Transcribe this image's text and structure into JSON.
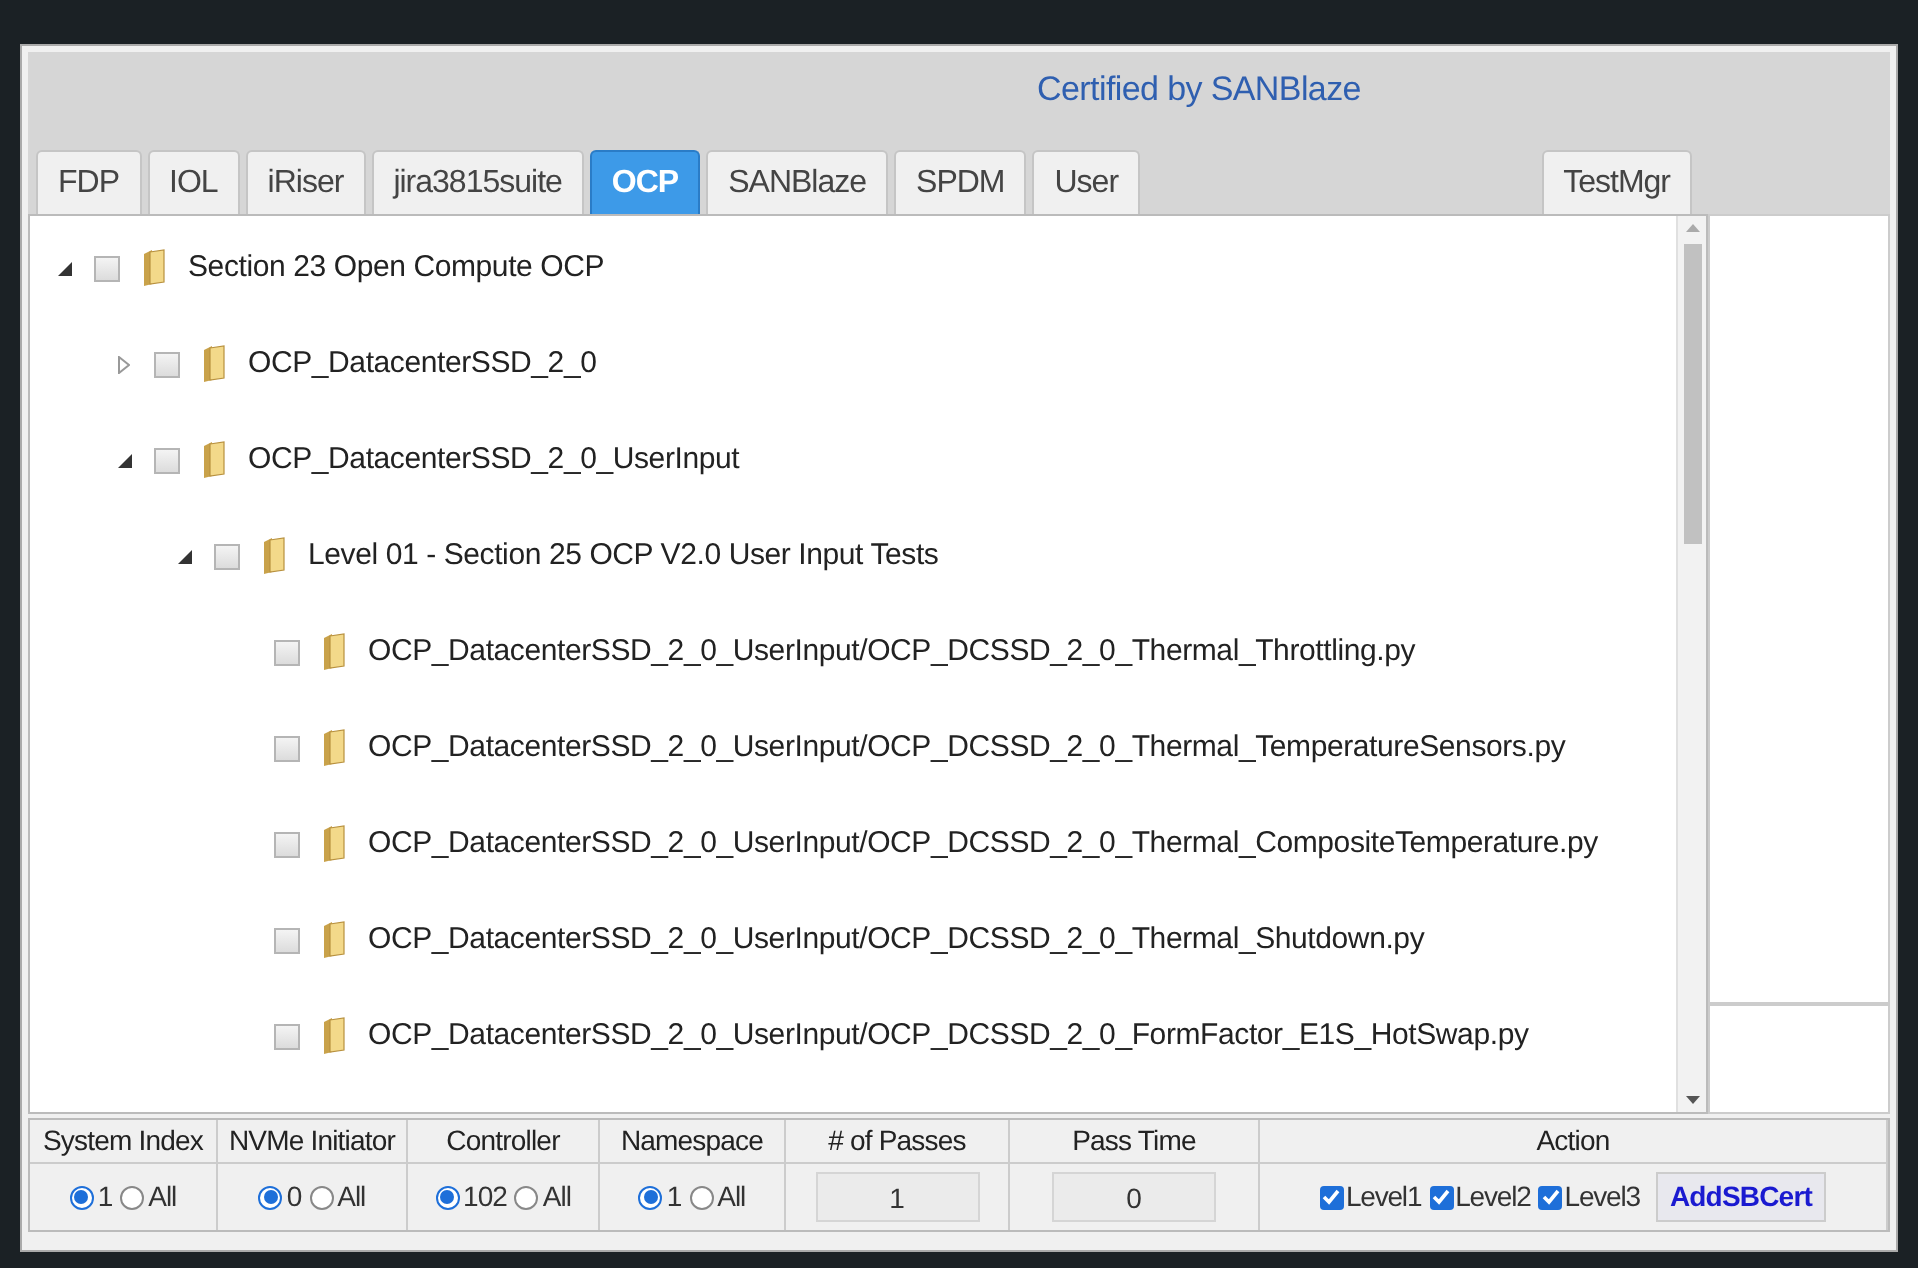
{
  "header": {
    "title": "Certified by SANBlaze"
  },
  "tabs": [
    {
      "label": "FDP",
      "selected": false
    },
    {
      "label": "IOL",
      "selected": false
    },
    {
      "label": "iRiser",
      "selected": false
    },
    {
      "label": "jira3815suite",
      "selected": false
    },
    {
      "label": "OCP",
      "selected": true
    },
    {
      "label": "SANBlaze",
      "selected": false
    },
    {
      "label": "SPDM",
      "selected": false
    },
    {
      "label": "User",
      "selected": false
    },
    {
      "label": "TestMgr",
      "selected": false
    }
  ],
  "tree": [
    {
      "label": "Section 23 Open Compute OCP",
      "expanded": true,
      "checked": false,
      "children": [
        {
          "label": "OCP_DatacenterSSD_2_0",
          "expanded": false,
          "checked": false
        },
        {
          "label": "OCP_DatacenterSSD_2_0_UserInput",
          "expanded": true,
          "checked": false,
          "children": [
            {
              "label": "Level 01 - Section 25 OCP V2.0 User Input Tests",
              "expanded": true,
              "checked": false,
              "children": [
                {
                  "label": "OCP_DatacenterSSD_2_0_UserInput/OCP_DCSSD_2_0_Thermal_Throttling.py",
                  "checked": false
                },
                {
                  "label": "OCP_DatacenterSSD_2_0_UserInput/OCP_DCSSD_2_0_Thermal_TemperatureSensors.py",
                  "checked": false
                },
                {
                  "label": "OCP_DatacenterSSD_2_0_UserInput/OCP_DCSSD_2_0_Thermal_CompositeTemperature.py",
                  "checked": false
                },
                {
                  "label": "OCP_DatacenterSSD_2_0_UserInput/OCP_DCSSD_2_0_Thermal_Shutdown.py",
                  "checked": false
                },
                {
                  "label": "OCP_DatacenterSSD_2_0_UserInput/OCP_DCSSD_2_0_FormFactor_E1S_HotSwap.py",
                  "checked": false
                }
              ]
            }
          ]
        }
      ]
    }
  ],
  "controls": [
    {
      "kind": "radios",
      "header": "System Index",
      "options": [
        {
          "label": "1",
          "selected": true
        },
        {
          "label": "All",
          "selected": false
        }
      ]
    },
    {
      "kind": "radios",
      "header": "NVMe Initiator",
      "options": [
        {
          "label": "0",
          "selected": true
        },
        {
          "label": "All",
          "selected": false
        }
      ]
    },
    {
      "kind": "radios",
      "header": "Controller",
      "options": [
        {
          "label": "102",
          "selected": true
        },
        {
          "label": "All",
          "selected": false
        }
      ]
    },
    {
      "kind": "radios",
      "header": "Namespace",
      "options": [
        {
          "label": "1",
          "selected": true
        },
        {
          "label": "All",
          "selected": false
        }
      ]
    },
    {
      "kind": "input",
      "header": "# of Passes",
      "value": "1"
    },
    {
      "kind": "input",
      "header": "Pass Time",
      "value": "0"
    },
    {
      "kind": "action",
      "header": "Action",
      "checks": [
        {
          "label": "Level1",
          "checked": true
        },
        {
          "label": "Level2",
          "checked": true
        },
        {
          "label": "Level3",
          "checked": true
        }
      ],
      "button": "AddSBCert"
    }
  ]
}
